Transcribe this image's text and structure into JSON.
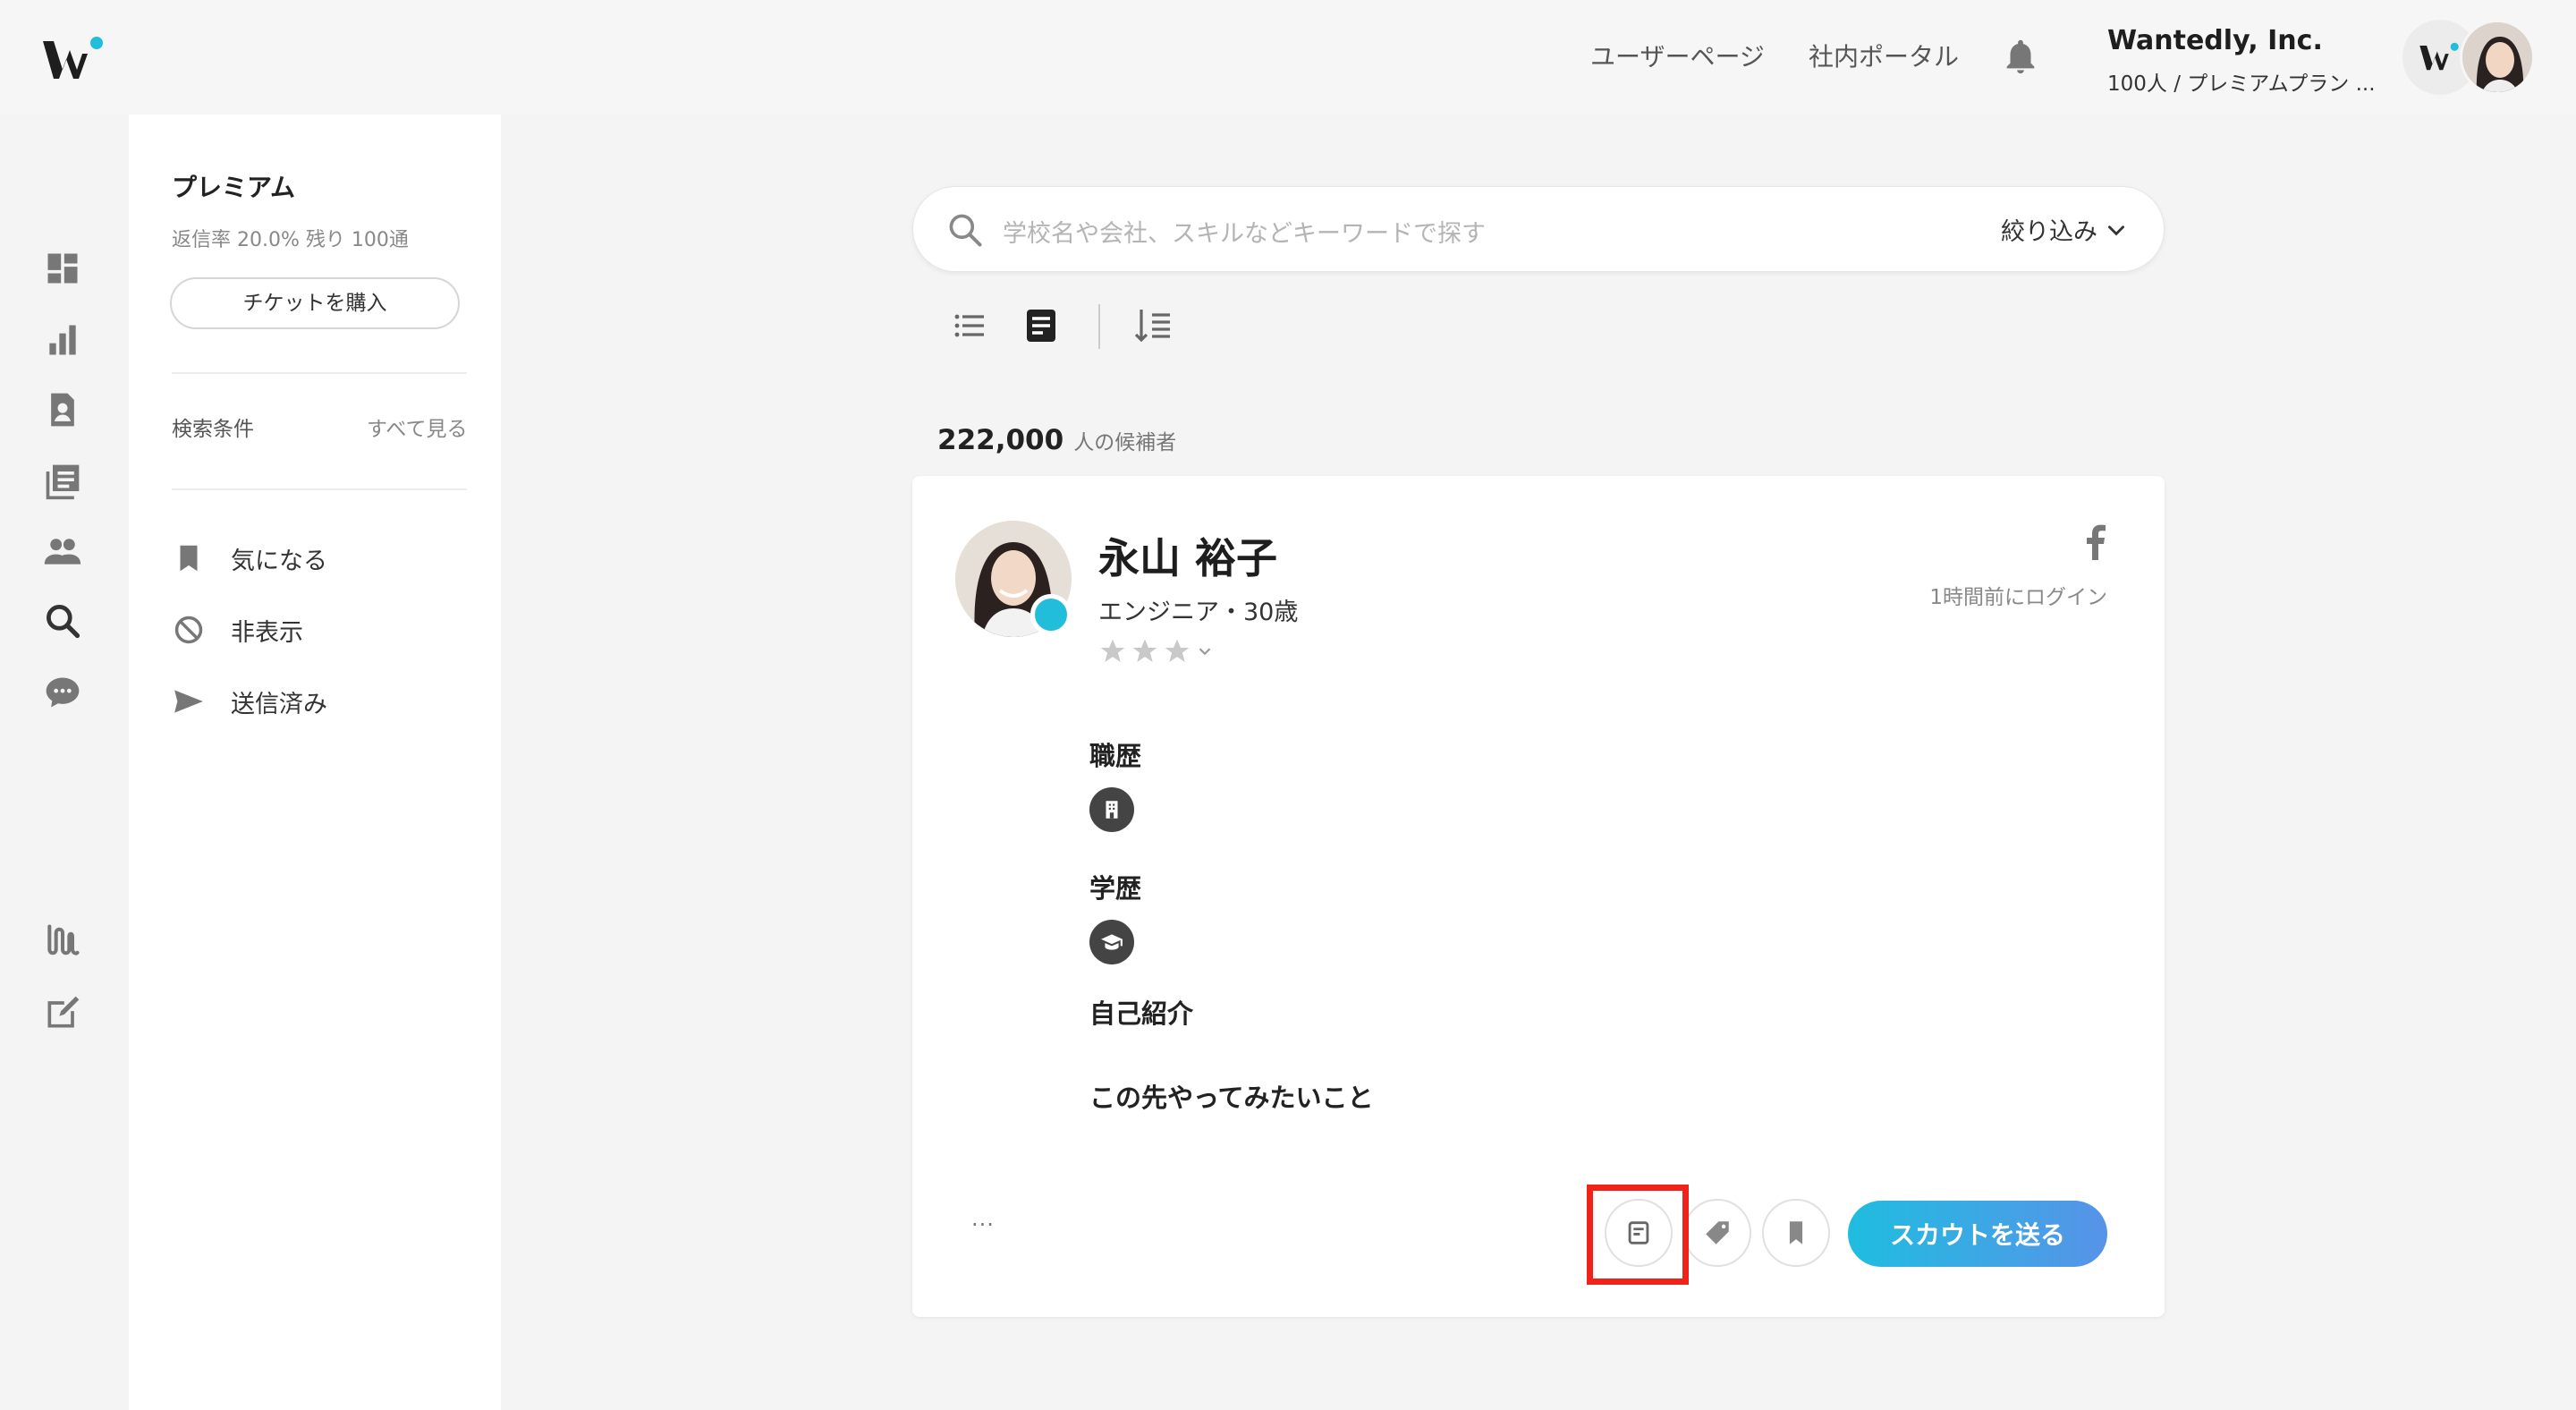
{
  "header": {
    "nav_user_page": "ユーザーページ",
    "nav_portal": "社内ポータル",
    "company_name": "Wantedly, Inc.",
    "company_plan": "100人 / プレミアムプラン ..."
  },
  "sidebar": {
    "title": "プレミアム",
    "subtitle": "返信率 20.0%  残り 100通",
    "ticket_button": "チケットを購入",
    "search_conditions_label": "検索条件",
    "see_all_link": "すべて見る",
    "items": [
      {
        "label": "気になる",
        "icon": "bookmark-icon"
      },
      {
        "label": "非表示",
        "icon": "hide-icon"
      },
      {
        "label": "送信済み",
        "icon": "send-icon"
      }
    ]
  },
  "search": {
    "placeholder": "学校名や会社、スキルなどキーワードで探す",
    "filter_label": "絞り込み"
  },
  "results": {
    "count": "222,000",
    "count_unit": "人の候補者"
  },
  "candidate": {
    "name": "永山 裕子",
    "role_age": "エンジニア・30歳",
    "last_login": "1時間前にログイン",
    "rating_stars": 3,
    "sections": {
      "work_history": "職歴",
      "education": "学歴",
      "self_intro": "自己紹介",
      "want_to_do": "この先やってみたいこと"
    },
    "more_label": "...",
    "scout_button": "スカウトを送る"
  },
  "colors": {
    "accent_cyan": "#21bddb",
    "scout_gradient_start": "#1fbde0",
    "scout_gradient_end": "#5793e8",
    "highlight_red": "#f0231a"
  }
}
